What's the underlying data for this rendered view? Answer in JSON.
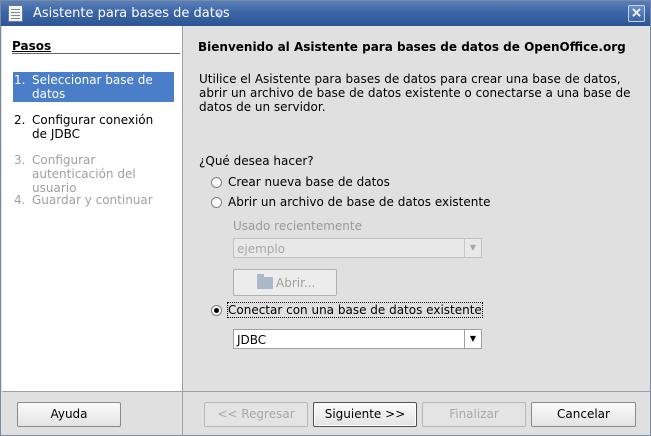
{
  "window": {
    "title": "Asistente para bases de datos"
  },
  "sidebar": {
    "heading": "Pasos",
    "steps": [
      {
        "num": "1.",
        "label": "Seleccionar base de datos",
        "state": "active"
      },
      {
        "num": "2.",
        "label": "Configurar conexión de JDBC",
        "state": "enabled"
      },
      {
        "num": "3.",
        "label": "Configurar autenticación del usuario",
        "state": "disabled"
      },
      {
        "num": "4.",
        "label": "Guardar y continuar",
        "state": "disabled"
      }
    ]
  },
  "main": {
    "heading": "Bienvenido al Asistente para bases de datos de OpenOffice.org",
    "intro": "Utilice el Asistente para bases de datos para crear una base de datos, abrir un archivo de base de datos existente o conectarse a una base de datos de un servidor.",
    "question": "¿Qué desea hacer?",
    "option_create": "Crear nueva base de datos",
    "option_open": "Abrir un archivo de base de datos existente",
    "recent_label": "Usado recientemente",
    "recent_value": "ejemplo",
    "open_button": "Abrir...",
    "option_connect": "Conectar con una base de datos existente",
    "connect_type": "JDBC",
    "selected_option": "connect"
  },
  "footer": {
    "help": "Ayuda",
    "back": "<< Regresar",
    "next": "Siguiente >>",
    "finish": "Finalizar",
    "cancel": "Cancelar"
  },
  "colors": {
    "titlebar": "#3d66a8",
    "selection": "#4a7ec8"
  }
}
